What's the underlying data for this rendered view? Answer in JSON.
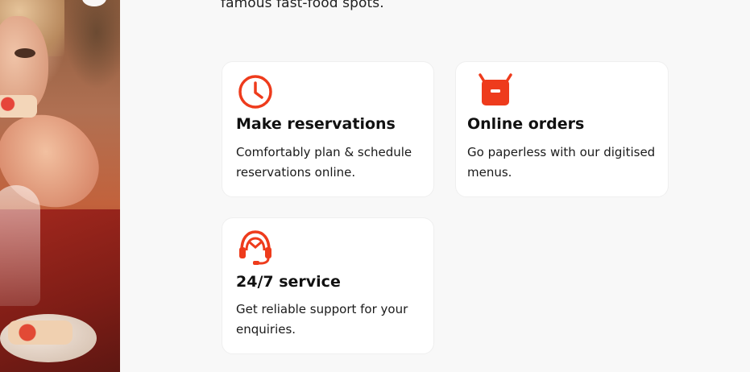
{
  "intro": {
    "text": "famous fast-food spots."
  },
  "features": [
    {
      "icon": "clock-icon",
      "title": "Make reservations",
      "description": "Comfortably plan & schedule reservations online."
    },
    {
      "icon": "shopping-bag-icon",
      "title": "Online orders",
      "description": "Go paperless with our digitised menus."
    },
    {
      "icon": "headset-support-icon",
      "title": "24/7 service",
      "description": "Get reliable support for your enquiries."
    }
  ],
  "colors": {
    "accent": "#ee3b1c",
    "background": "#f8f8f8",
    "card": "#ffffff",
    "text": "#111111"
  }
}
